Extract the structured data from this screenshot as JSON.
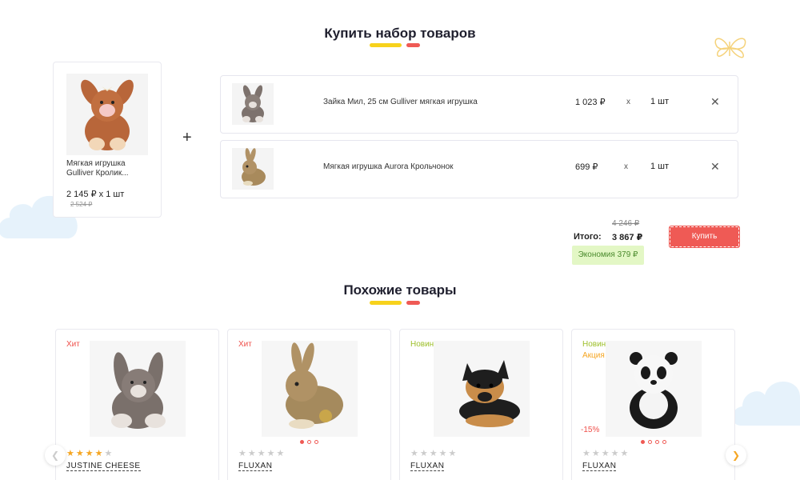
{
  "bundle": {
    "title": "Купить набор товаров",
    "main_product": {
      "name": "Мягкая игрушка Gulliver Кролик...",
      "price": "2 145 ₽ x 1 шт",
      "old_price": "2 524 ₽"
    },
    "items": [
      {
        "name": "Зайка Мил, 25 см Gulliver мягкая игрушка",
        "price": "1 023 ₽",
        "times": "x",
        "qty": "1 шт",
        "remove": "✕"
      },
      {
        "name": "Мягкая игрушка Aurora Крольчонок",
        "price": "699 ₽",
        "times": "x",
        "qty": "1 шт",
        "remove": "✕"
      }
    ],
    "plus": "+",
    "total_old": "4 246 ₽",
    "total_label": "Итого:",
    "total_value": "3 867 ₽",
    "economy": "Экономия 379 ₽",
    "buy_label": "Купить"
  },
  "similar": {
    "title": "Похожие товары",
    "prev_icon": "chevron-left-icon",
    "next_icon": "chevron-right-icon",
    "products": [
      {
        "badges": [
          "Хит"
        ],
        "rating": 4,
        "brand": "JUSTINE CHEESE",
        "discount": "",
        "image_dots": 0,
        "active_dot": 0
      },
      {
        "badges": [
          "Хит"
        ],
        "rating": 0,
        "brand": "FLUXAN",
        "discount": "",
        "image_dots": 3,
        "active_dot": 0
      },
      {
        "badges": [
          "Новинка"
        ],
        "rating": 0,
        "brand": "FLUXAN",
        "discount": "",
        "image_dots": 0,
        "active_dot": 0
      },
      {
        "badges": [
          "Новинка",
          "Акция"
        ],
        "rating": 0,
        "brand": "FLUXAN",
        "discount": "-15%",
        "image_dots": 4,
        "active_dot": 0
      }
    ]
  },
  "colors": {
    "accent_red": "#ef5a55",
    "accent_yellow": "#f7d21c",
    "badge_hit": "#ef4f4a",
    "badge_new": "#9dbf2a",
    "badge_sale": "#f5a623",
    "economy_bg": "#e3f7c5"
  }
}
